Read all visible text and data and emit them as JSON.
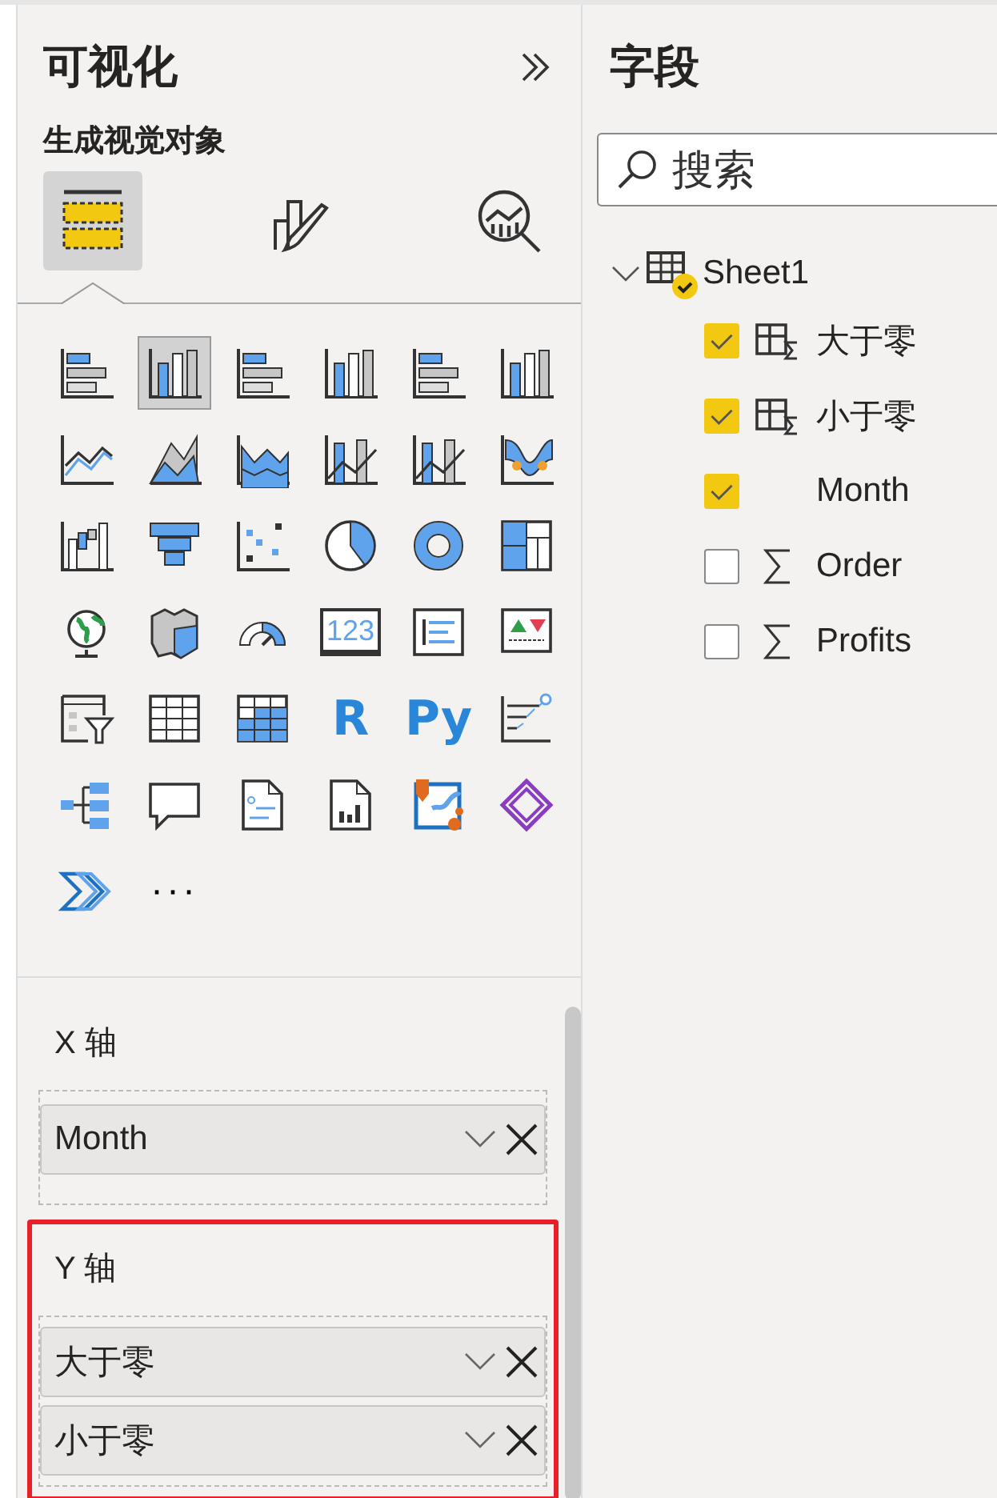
{
  "visualizations": {
    "title": "可视化",
    "subtitle": "生成视觉对象",
    "tabs": [
      {
        "kind": "build",
        "selected": true
      },
      {
        "kind": "format",
        "selected": false
      },
      {
        "kind": "analytics",
        "selected": false
      }
    ],
    "visuals": [
      {
        "kind": "bar-h",
        "selected": false
      },
      {
        "kind": "column",
        "selected": true
      },
      {
        "kind": "bar-h",
        "selected": false
      },
      {
        "kind": "column",
        "selected": false
      },
      {
        "kind": "bar-h",
        "selected": false
      },
      {
        "kind": "column",
        "selected": false
      },
      {
        "kind": "line",
        "selected": false
      },
      {
        "kind": "area",
        "selected": false
      },
      {
        "kind": "stacked-area",
        "selected": false
      },
      {
        "kind": "combo",
        "selected": false
      },
      {
        "kind": "combo",
        "selected": false
      },
      {
        "kind": "ribbon",
        "selected": false
      },
      {
        "kind": "waterfall",
        "selected": false
      },
      {
        "kind": "funnel",
        "selected": false
      },
      {
        "kind": "scatter",
        "selected": false
      },
      {
        "kind": "pie",
        "selected": false
      },
      {
        "kind": "donut",
        "selected": false
      },
      {
        "kind": "treemap",
        "selected": false
      },
      {
        "kind": "globe",
        "selected": false
      },
      {
        "kind": "filled-map",
        "selected": false
      },
      {
        "kind": "gauge",
        "selected": false
      },
      {
        "kind": "card",
        "label": "123",
        "selected": false
      },
      {
        "kind": "multi-card",
        "selected": false
      },
      {
        "kind": "kpi",
        "selected": false
      },
      {
        "kind": "slicer",
        "selected": false
      },
      {
        "kind": "table",
        "selected": false
      },
      {
        "kind": "matrix",
        "selected": false
      },
      {
        "kind": "letters",
        "label": "R",
        "selected": false
      },
      {
        "kind": "letters",
        "label": "Py",
        "selected": false
      },
      {
        "kind": "influencers",
        "selected": false
      },
      {
        "kind": "decomposition",
        "selected": false
      },
      {
        "kind": "qa",
        "selected": false
      },
      {
        "kind": "narrative",
        "selected": false
      },
      {
        "kind": "paginated",
        "selected": false
      },
      {
        "kind": "azure-map",
        "selected": false
      },
      {
        "kind": "power-apps",
        "selected": false
      },
      {
        "kind": "power-automate",
        "selected": false
      },
      {
        "kind": "more",
        "label": "···",
        "selected": false
      }
    ],
    "wells": [
      {
        "label": "X 轴",
        "highlighted": false,
        "fields": [
          "Month"
        ]
      },
      {
        "label": "Y 轴",
        "highlighted": true,
        "fields": [
          "大于零",
          "小于零"
        ]
      }
    ]
  },
  "fields": {
    "title": "字段",
    "search": {
      "placeholder": "搜索"
    },
    "tables": [
      {
        "name": "Sheet1",
        "expanded": true,
        "checked": true,
        "children": [
          {
            "name": "大于零",
            "kind": "measure",
            "checked": true
          },
          {
            "name": "小于零",
            "kind": "measure",
            "checked": true
          },
          {
            "name": "Month",
            "kind": "plain",
            "checked": true
          },
          {
            "name": "Order",
            "kind": "sum",
            "checked": false
          },
          {
            "name": "Profits",
            "kind": "sum",
            "checked": false
          }
        ]
      }
    ]
  }
}
